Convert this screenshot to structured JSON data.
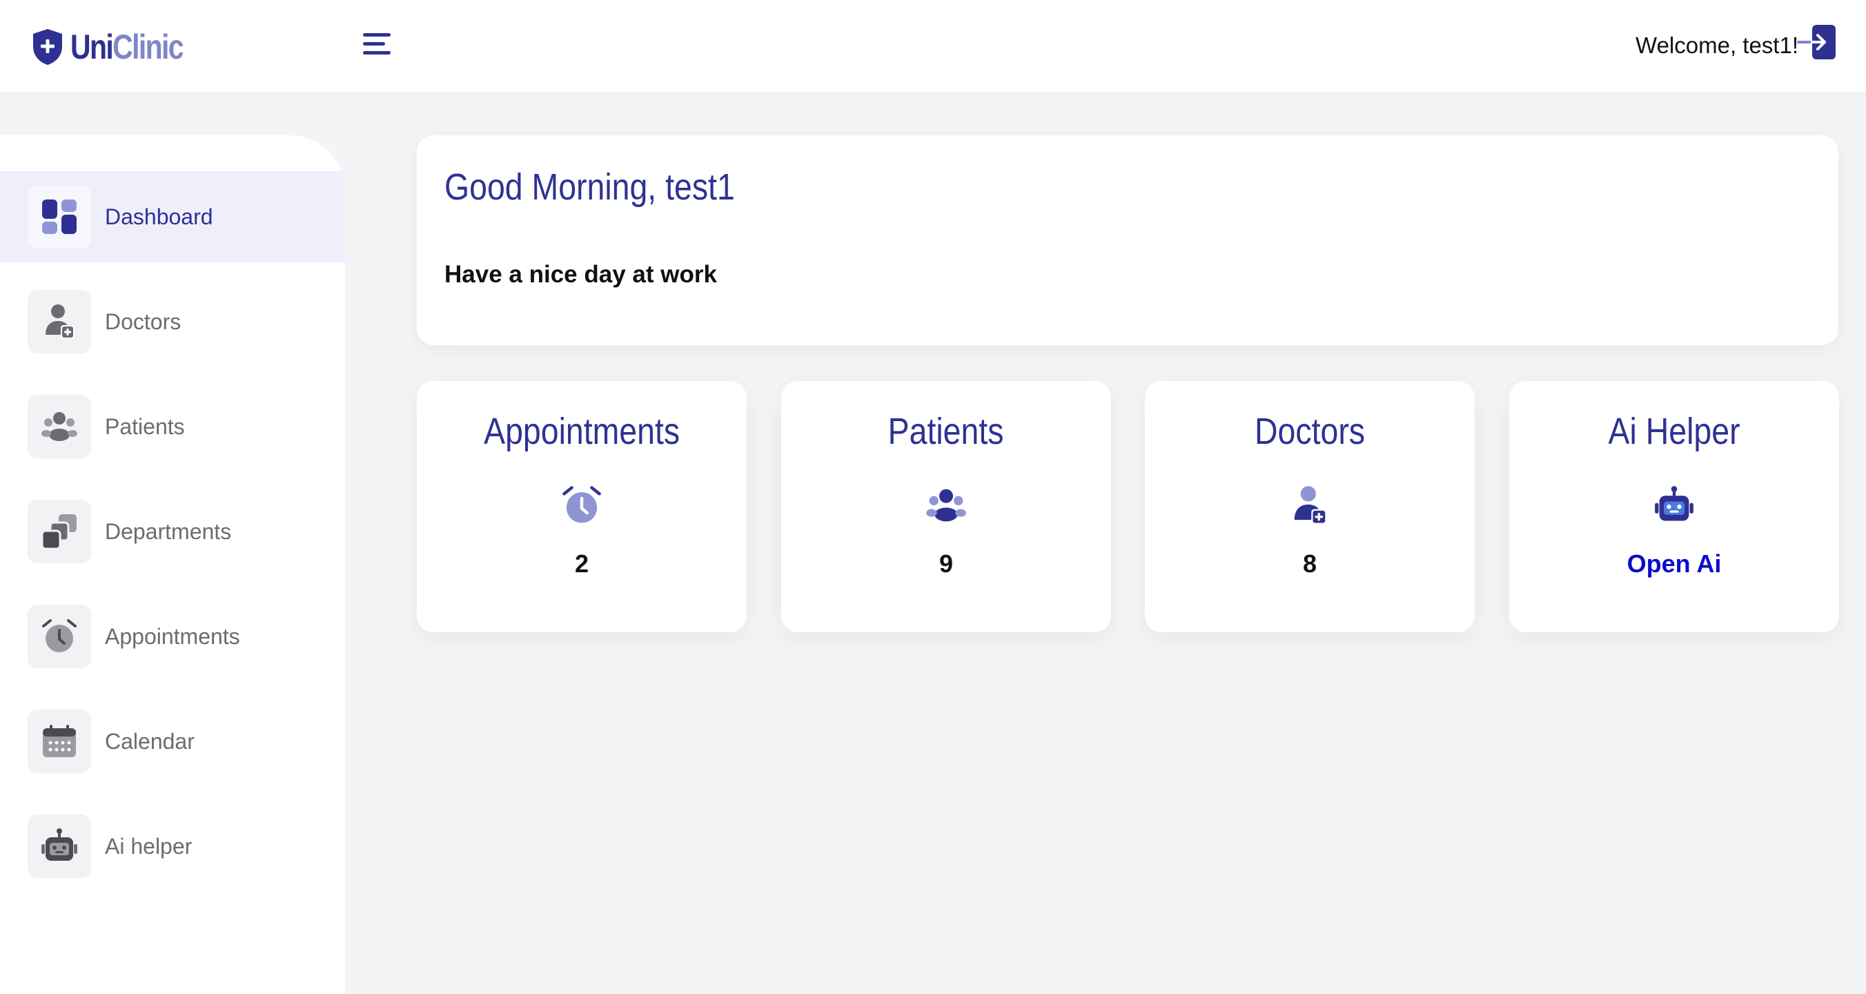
{
  "header": {
    "logo_uni": "Uni",
    "logo_clinic": "Clinic",
    "welcome": "Welcome, test1!"
  },
  "sidebar": {
    "items": [
      {
        "label": "Dashboard",
        "icon": "dashboard-icon",
        "active": true
      },
      {
        "label": "Doctors",
        "icon": "doctor-icon"
      },
      {
        "label": "Patients",
        "icon": "patients-icon"
      },
      {
        "label": "Departments",
        "icon": "departments-icon"
      },
      {
        "label": "Appointments",
        "icon": "alarm-clock-icon"
      },
      {
        "label": "Calendar",
        "icon": "calendar-icon"
      },
      {
        "label": "Ai helper",
        "icon": "robot-icon"
      }
    ]
  },
  "greeting": {
    "title": "Good Morning, test1",
    "subtitle": "Have a nice day at work"
  },
  "stats": [
    {
      "title": "Appointments",
      "icon": "alarm-clock-icon",
      "value": "2"
    },
    {
      "title": "Patients",
      "icon": "patients-icon",
      "value": "9"
    },
    {
      "title": "Doctors",
      "icon": "doctor-icon",
      "value": "8"
    },
    {
      "title": "Ai Helper",
      "icon": "robot-icon",
      "link": "Open Ai"
    }
  ],
  "colors": {
    "brand_dark": "#2e3192",
    "brand_light": "#7e86c9",
    "sidebar_active_bg": "#efeffb",
    "link": "#0b0bcc"
  }
}
